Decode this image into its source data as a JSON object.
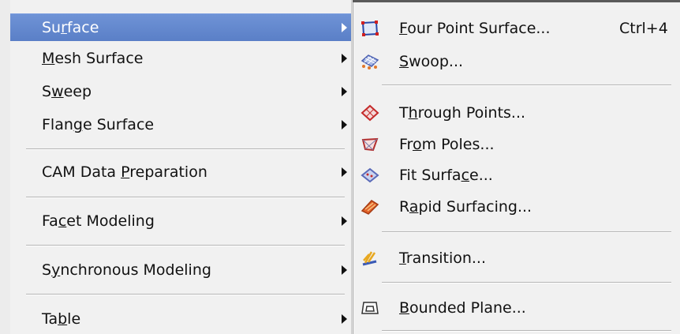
{
  "left_menu": {
    "items": [
      {
        "pre": "Su",
        "acc": "r",
        "post": "face"
      },
      {
        "pre": "",
        "acc": "M",
        "post": "esh Surface"
      },
      {
        "pre": "S",
        "acc": "w",
        "post": "eep"
      },
      {
        "pre": "Flan",
        "acc": "g",
        "post": "e Surface"
      },
      {
        "pre": "CAM Data ",
        "acc": "P",
        "post": "reparation"
      },
      {
        "pre": "Fa",
        "acc": "c",
        "post": "et Modeling"
      },
      {
        "pre": "S",
        "acc": "y",
        "post": "nchronous Modeling"
      },
      {
        "pre": "Ta",
        "acc": "b",
        "post": "le"
      }
    ]
  },
  "right_menu": {
    "items": [
      {
        "pre": "",
        "acc": "F",
        "post": "our Point Surface...",
        "shortcut": "Ctrl+4",
        "icon": "four-point-surface-icon"
      },
      {
        "pre": "",
        "acc": "S",
        "post": "woop...",
        "icon": "swoop-icon"
      },
      {
        "pre": "T",
        "acc": "h",
        "post": "rough Points...",
        "icon": "through-points-icon"
      },
      {
        "pre": "Fr",
        "acc": "o",
        "post": "m Poles...",
        "icon": "from-poles-icon"
      },
      {
        "pre": "Fit Surfa",
        "acc": "c",
        "post": "e...",
        "icon": "fit-surface-icon"
      },
      {
        "pre": "R",
        "acc": "a",
        "post": "pid Surfacing...",
        "icon": "rapid-surfacing-icon"
      },
      {
        "pre": "",
        "acc": "T",
        "post": "ransition...",
        "icon": "transition-icon"
      },
      {
        "pre": "",
        "acc": "B",
        "post": "ounded Plane...",
        "icon": "bounded-plane-icon"
      }
    ]
  },
  "colors": {
    "highlight": "#5f85cc",
    "menu_bg": "#f1f1f1"
  }
}
